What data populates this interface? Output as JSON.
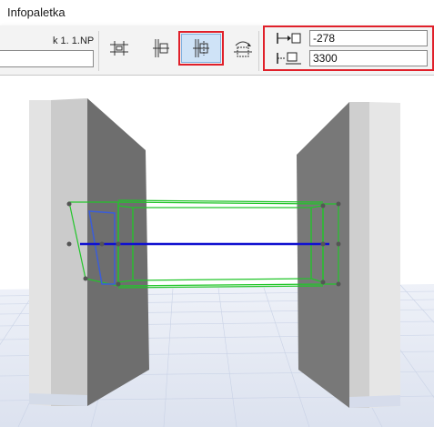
{
  "window": {
    "title": "Infopaletka"
  },
  "palette": {
    "story_label": "k 1. 1.NP",
    "story_value": "",
    "tools": [
      {
        "name": "gear-icon-1",
        "active": false
      },
      {
        "name": "gear-icon-2",
        "active": false
      },
      {
        "name": "gear-icon-3",
        "active": true
      },
      {
        "name": "gear-icon-4",
        "active": false
      }
    ],
    "offset_value": "-278",
    "length_value": "3300"
  },
  "colors": {
    "highlight": "#e0202a",
    "active_tool": "#cfe3f7",
    "selection_green": "#22c52a",
    "reference_line_blue": "#1010d0"
  }
}
